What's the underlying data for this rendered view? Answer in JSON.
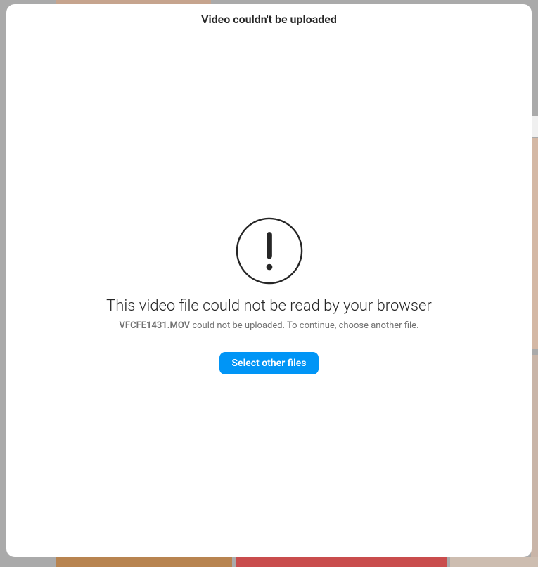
{
  "modal": {
    "title": "Video couldn't be uploaded"
  },
  "error": {
    "headline": "This video file could not be read by your browser",
    "filename": "VFCFE1431.MOV",
    "suffix": " could not be uploaded. To continue, choose another file.",
    "button_label": "Select other files"
  }
}
